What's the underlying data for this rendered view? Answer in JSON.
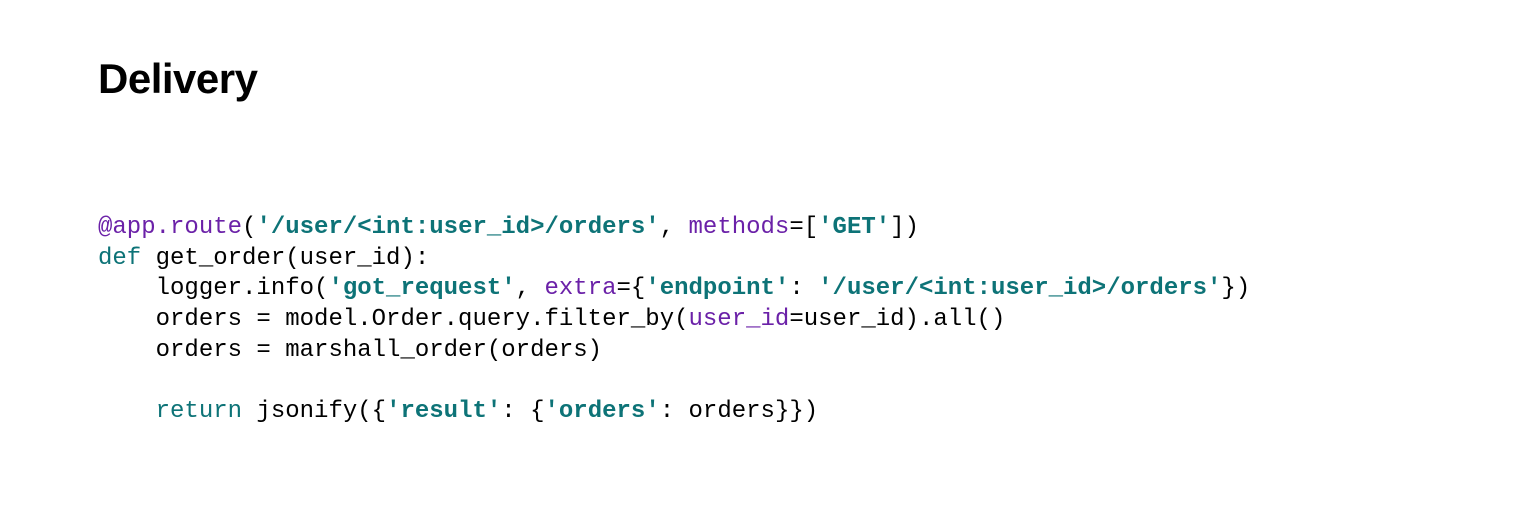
{
  "title": "Delivery",
  "code": {
    "decorator_at": "@app.route",
    "decorator_open": "(",
    "route_str": "'/user/<int:user_id>/orders'",
    "methods_kw": "methods",
    "methods_eq": "=[",
    "get_str": "'GET'",
    "decorator_close": "])",
    "def_kw": "def",
    "func_sig": " get_order(user_id):",
    "line3a": "    logger.info(",
    "got_request": "'got_request'",
    "line3b": ", ",
    "extra_kw": "extra",
    "line3c": "={",
    "endpoint_key": "'endpoint'",
    "line3d": ": ",
    "endpoint_val": "'/user/<int:user_id>/orders'",
    "line3e": "})",
    "line4a": "    orders = model.Order.query.filter_by(",
    "userid_kw": "user_id",
    "line4b": "=user_id).all()",
    "line5": "    orders = marshall_order(orders)",
    "blank": "",
    "line7a": "    ",
    "return_kw": "return",
    "line7b": " jsonify({",
    "result_key": "'result'",
    "line7c": ": {",
    "orders_key": "'orders'",
    "line7d": ": orders}})"
  }
}
